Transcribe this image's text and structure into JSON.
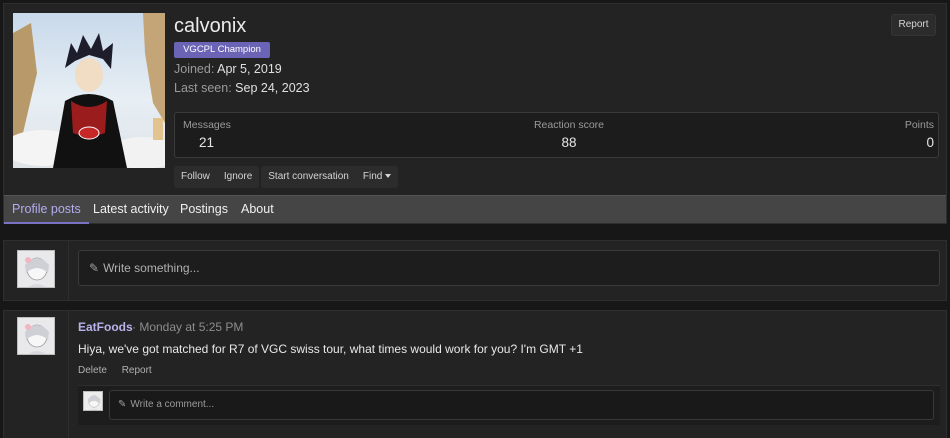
{
  "profile": {
    "username": "calvonix",
    "badge": "VGCPL Champion",
    "joined_label": "Joined:",
    "joined_value": "Apr 5, 2019",
    "last_seen_label": "Last seen:",
    "last_seen_value": "Sep 24, 2023",
    "report_label": "Report"
  },
  "stats": [
    {
      "label": "Messages",
      "value": "21"
    },
    {
      "label": "Reaction score",
      "value": "88"
    },
    {
      "label": "Points",
      "value": "0"
    }
  ],
  "actions": {
    "follow": "Follow",
    "ignore": "Ignore",
    "start_conversation": "Start conversation",
    "find": "Find"
  },
  "tabs": [
    {
      "label": "Profile posts",
      "active": true
    },
    {
      "label": "Latest activity",
      "active": false
    },
    {
      "label": "Postings",
      "active": false
    },
    {
      "label": "About",
      "active": false
    }
  ],
  "composer": {
    "placeholder": "Write something..."
  },
  "post": {
    "author": "EatFoods",
    "time": "· Monday at 5:25 PM",
    "body": "Hiya, we've got matched for R7 of VGC swiss tour, what times would work for you? I'm GMT +1",
    "delete_label": "Delete",
    "report_label": "Report",
    "comment_placeholder": "Write a comment..."
  },
  "colors": {
    "accent": "#6b63b5",
    "active_tab": "#b3acef",
    "author_link": "#b8b2ea"
  }
}
